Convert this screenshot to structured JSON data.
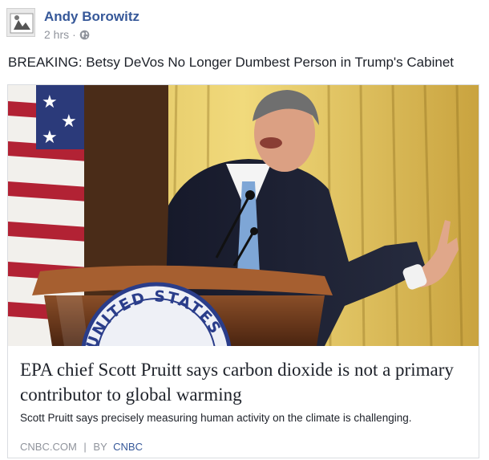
{
  "post": {
    "author": "Andy Borowitz",
    "time": "2 hrs",
    "separator": "·",
    "privacy_icon": "globe-icon",
    "text": "BREAKING: Betsy DeVos No Longer Dumbest Person in Trump's Cabinet"
  },
  "link_card": {
    "image_alt": "Scott Pruitt speaking at a podium with a United States seal",
    "podium_seal_text": "UNITED STATES",
    "title": "EPA chief Scott Pruitt says carbon dioxide is not a primary contributor to global warming",
    "description": "Scott Pruitt says precisely measuring human activity on the climate is challenging.",
    "domain": "CNBC.COM",
    "divider": "|",
    "by_prefix": "BY",
    "by_name": "CNBC"
  },
  "colors": {
    "link_blue": "#365899",
    "meta_gray": "#90949c",
    "text_dark": "#1d2129",
    "card_border": "#dadde1"
  }
}
